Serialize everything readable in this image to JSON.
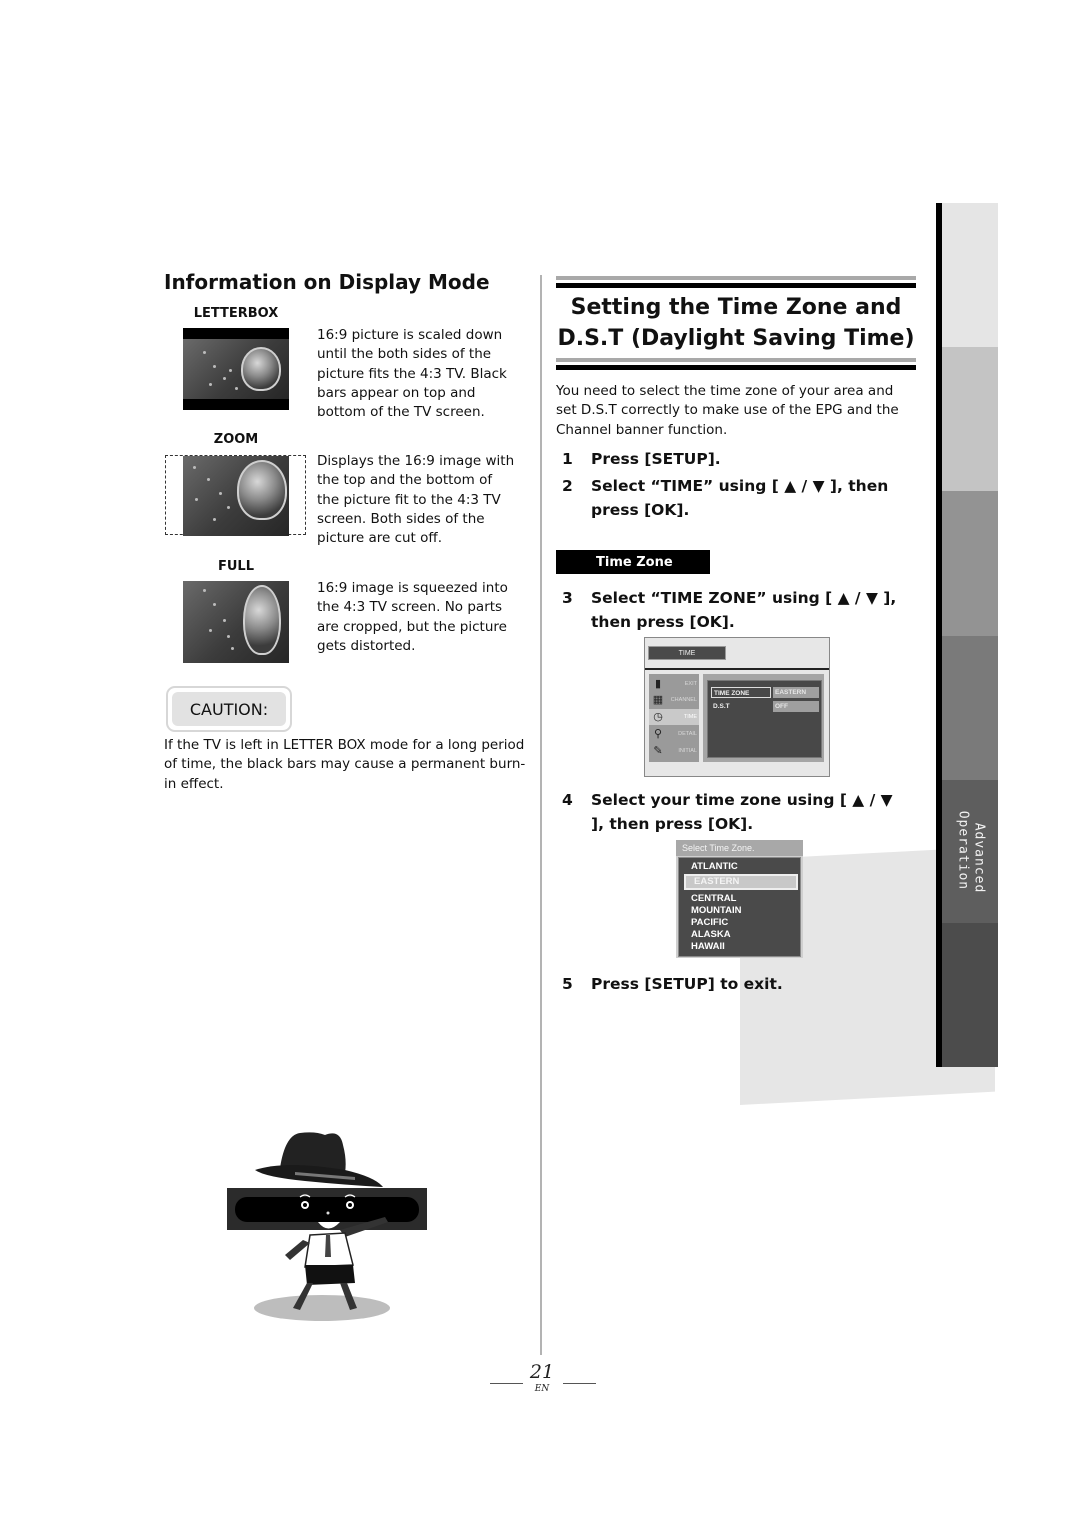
{
  "left": {
    "heading": "Information on Display Mode",
    "modes": [
      {
        "title": "LETTERBOX",
        "description": "16:9 picture is scaled down until the both sides of the picture fits the 4:3 TV. Black bars appear on top and bottom of the TV screen."
      },
      {
        "title": "ZOOM",
        "description": "Displays the 16:9 image with the top and the bottom of the picture fit to the 4:3 TV screen. Both sides of the picture are cut off."
      },
      {
        "title": "FULL",
        "description": "16:9 image is squeezed into the 4:3 TV screen. No parts are cropped, but the picture gets distorted."
      }
    ],
    "caution_label": "CAUTION:",
    "caution_text": "If the TV is left in LETTER BOX mode for a long period of time, the black bars may cause a permanent burn-in effect."
  },
  "right": {
    "heading_line1": "Setting the Time Zone and",
    "heading_line2": "D.S.T (Daylight Saving Time)",
    "intro": "You need to select the time zone of your area and set D.S.T correctly to make use of the EPG and the Channel banner function.",
    "steps": [
      {
        "num": "1",
        "text": "Press [SETUP]."
      },
      {
        "num": "2",
        "text": "Select “TIME” using [ ▲ / ▼ ], then press [OK]."
      },
      {
        "num": "3",
        "text": "Select “TIME ZONE” using [ ▲ / ▼ ], then press [OK]."
      },
      {
        "num": "4",
        "text": "Select your time zone using [ ▲ / ▼ ], then press [OK]."
      },
      {
        "num": "5",
        "text": "Press [SETUP] to exit."
      }
    ],
    "section_banner": "Time Zone",
    "screen_time": {
      "title": "TIME",
      "menu": [
        {
          "label": "EXIT",
          "icon": "door-icon"
        },
        {
          "label": "CHANNEL",
          "icon": "channel-icon"
        },
        {
          "label": "TIME",
          "icon": "clock-icon",
          "selected": true
        },
        {
          "label": "DETAIL",
          "icon": "magnifier-icon"
        },
        {
          "label": "INITIAL",
          "icon": "notepad-icon"
        }
      ],
      "rows": [
        {
          "label": "TIME ZONE",
          "value": "EASTERN"
        },
        {
          "label": "D.S.T",
          "value": "OFF"
        }
      ]
    },
    "screen_zone": {
      "title": "Select Time Zone.",
      "options": [
        "ATLANTIC",
        "EASTERN",
        "CENTRAL",
        "MOUNTAIN",
        "PACIFIC",
        "ALASKA",
        "HAWAII"
      ],
      "selected": "EASTERN"
    }
  },
  "side_tab": {
    "line1": "Advanced",
    "line2": "Operation",
    "tab_colors": [
      "#e5e5e5",
      "#c4c4c4",
      "#939393",
      "#7a7a7a",
      "#5e5e5e",
      "#4c4c4c"
    ]
  },
  "footer": {
    "page_number": "21",
    "language": "EN"
  }
}
